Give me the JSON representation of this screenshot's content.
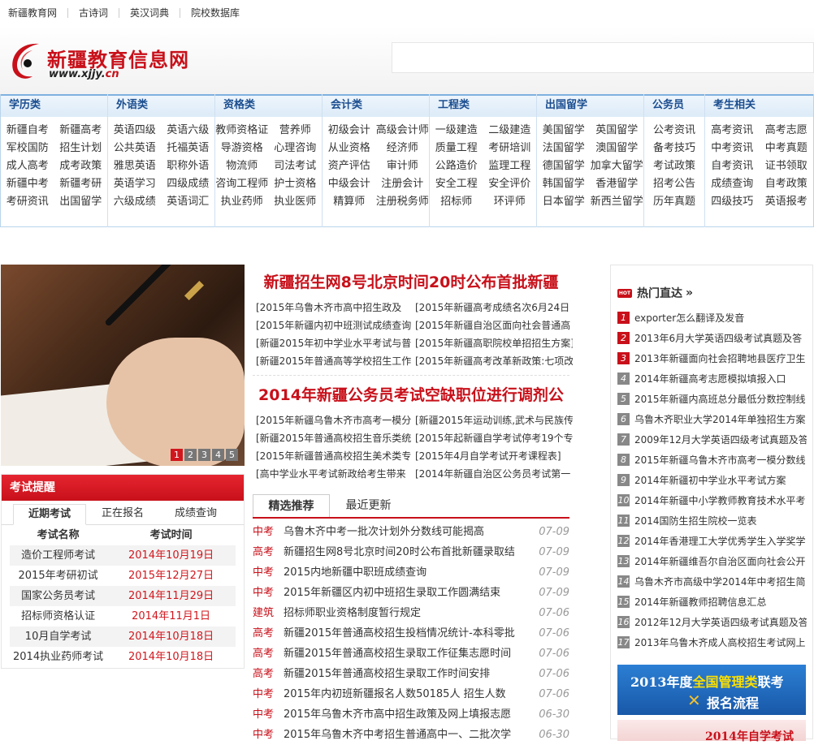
{
  "topnav": [
    "新疆教育网",
    "古诗词",
    "英汉词典",
    "院校数据库"
  ],
  "logo": {
    "title": "新疆教育信息网",
    "url_main": "www.xjjy.",
    "url_tld": "cn"
  },
  "categories": [
    {
      "title": "学历类",
      "links": [
        "新疆自考",
        "新疆高考",
        "军校国防",
        "招生计划",
        "成人高考",
        "成考政策",
        "新疆中考",
        "新疆考研",
        "考研资讯",
        "出国留学"
      ]
    },
    {
      "title": "外语类",
      "links": [
        "英语四级",
        "英语六级",
        "公共英语",
        "托福英语",
        "雅思英语",
        "职称外语",
        "英语学习",
        "四级成绩",
        "六级成绩",
        "英语词汇"
      ]
    },
    {
      "title": "资格类",
      "links": [
        "教师资格证",
        "营养师",
        "导游资格",
        "心理咨询",
        "物流师",
        "司法考试",
        "咨询工程师",
        "护士资格",
        "执业药师",
        "执业医师"
      ]
    },
    {
      "title": "会计类",
      "links": [
        "初级会计",
        "高级会计师",
        "从业资格",
        "经济师",
        "资产评估",
        "审计师",
        "中级会计",
        "注册会计",
        "精算师",
        "注册税务师"
      ]
    },
    {
      "title": "工程类",
      "links": [
        "一级建造",
        "二级建造",
        "质量工程",
        "考研培训",
        "公路造价",
        "监理工程",
        "安全工程",
        "安全评价",
        "招标师",
        "环评师"
      ]
    },
    {
      "title": "出国留学",
      "links": [
        "美国留学",
        "英国留学",
        "法国留学",
        "澳国留学",
        "德国留学",
        "加拿大留学",
        "韩国留学",
        "香港留学",
        "日本留学",
        "新西兰留学"
      ]
    },
    {
      "title": "公务员",
      "links": [
        "公考资讯",
        "备考技巧",
        "考试政策",
        "招考公告",
        "历年真题"
      ]
    },
    {
      "title": "考生相关",
      "links": [
        "高考资讯",
        "高考志愿",
        "中考资讯",
        "中考真题",
        "自考资讯",
        "证书领取",
        "成绩查询",
        "自考政策",
        "四级技巧",
        "英语报考"
      ]
    }
  ],
  "banner": {
    "pages": [
      "1",
      "2",
      "3",
      "4",
      "5"
    ]
  },
  "remind": {
    "title": "考试提醒",
    "tabs": [
      "近期考试",
      "正在报名",
      "成绩查询"
    ],
    "col_name": "考试名称",
    "col_time": "考试时间",
    "rows": [
      {
        "name": "造价工程师考试",
        "time": "2014年10月19日"
      },
      {
        "name": "2015年考研初试",
        "time": "2015年12月27日"
      },
      {
        "name": "国家公务员考试",
        "time": "2014年11月29日"
      },
      {
        "name": "招标师资格认证",
        "time": "2014年11月1日"
      },
      {
        "name": "10月自学考试",
        "time": "2014年10月18日"
      },
      {
        "name": "2014执业药师考试",
        "time": "2014年10月18日"
      }
    ]
  },
  "headline1": "新疆招生网8号北京时间20时公布首批新疆",
  "sublinks1": [
    "[2015年乌鲁木齐市高中招生政及",
    "[2015年新疆高考成绩名次6月24日",
    "[2015年新疆内初中班测试成绩查询",
    "[2015年新疆自治区面向社会普通高",
    "[新疆2015年初中学业水平考试与普",
    "[2015年新疆高职院校单招招生方案]",
    "[新疆2015年普通高等学校招生工作",
    "[2015年新疆高考改革新政策:七项改"
  ],
  "headline2": "2014年新疆公务员考试空缺职位进行调剂公",
  "sublinks2": [
    "[2015年新疆乌鲁木齐市高考一模分",
    "[新疆2015年运动训练,武术与民族传",
    "[新疆2015年普通高校招生音乐类统",
    "[2015年起新疆自学考试停考19个专",
    "[2015年新疆普通高校招生美术类专",
    "[2015年4月自学考试开考课程表]",
    "[高中学业水平考试新政给考生带来",
    "[2014年新疆自治区公务员考试第一"
  ],
  "news_tabs": [
    "精选推荐",
    "最近更新"
  ],
  "news": [
    {
      "tag": "中考",
      "title": "乌鲁木齐中考一批次计划外分数线可能揭高",
      "date": "07-09"
    },
    {
      "tag": "高考",
      "title": "新疆招生网8号北京时间20时公布首批新疆录取结",
      "date": "07-09"
    },
    {
      "tag": "中考",
      "title": "2015内地新疆中职班成绩查询",
      "date": "07-09"
    },
    {
      "tag": "中考",
      "title": "2015年新疆区内初中班招生录取工作圆满结束",
      "date": "07-09"
    },
    {
      "tag": "建筑",
      "title": "招标师职业资格制度暂行规定",
      "date": "07-06"
    },
    {
      "tag": "高考",
      "title": "新疆2015年普通高校招生投档情况统计-本科零批",
      "date": "07-06"
    },
    {
      "tag": "高考",
      "title": "新疆2015年普通高校招生录取工作征集志愿时间",
      "date": "07-06"
    },
    {
      "tag": "高考",
      "title": "新疆2015年普通高校招生录取工作时间安排",
      "date": "07-06"
    },
    {
      "tag": "中考",
      "title": "2015年内初班新疆报名人数50185人 招生人数",
      "date": "07-06"
    },
    {
      "tag": "中考",
      "title": "2015年乌鲁木齐市高中招生政策及网上填报志愿",
      "date": "06-30"
    },
    {
      "tag": "中考",
      "title": "2015年乌鲁木齐中考招生普通高中一、二批次学",
      "date": "06-30"
    }
  ],
  "hot": {
    "title": "热门直达",
    "arrow": "»",
    "badge": "HOT",
    "items": [
      "exporter怎么翻译及发音",
      "2013年6月大学英语四级考试真题及答",
      "2013年新疆面向社会招聘地县医疗卫生",
      "2014年新疆高考志愿模拟填报入口",
      "2015年新疆内高班总分最低分数控制线",
      "乌鲁木齐职业大学2014年单独招生方案",
      "2009年12月大学英语四级考试真题及答",
      "2015年新疆乌鲁木齐市高考一模分数线",
      "2014年新疆初中学业水平考试方案",
      "2014年新疆中小学教师教育技术水平考",
      "2014国防生招生院校一览表",
      "2014年香港理工大学优秀学生入学奖学",
      "2014年新疆维吾尔自治区面向社会公开",
      "乌鲁木齐市高级中学2014年中考招生简",
      "2014年新疆教师招聘信息汇总",
      "2012年12月大学英语四级考试真题及答",
      "2013年乌鲁木齐成人高校招生考试网上"
    ]
  },
  "ad1": {
    "line1_a": "2013年度",
    "line1_b": "全国管理类",
    "line1_c": "联考",
    "line2": "报名流程",
    "mark": "✕"
  },
  "ad2": {
    "text": "2014年自学考试"
  },
  "colors": {
    "brand_red": "#c8101a",
    "nav_blue": "#1a4d8f"
  }
}
